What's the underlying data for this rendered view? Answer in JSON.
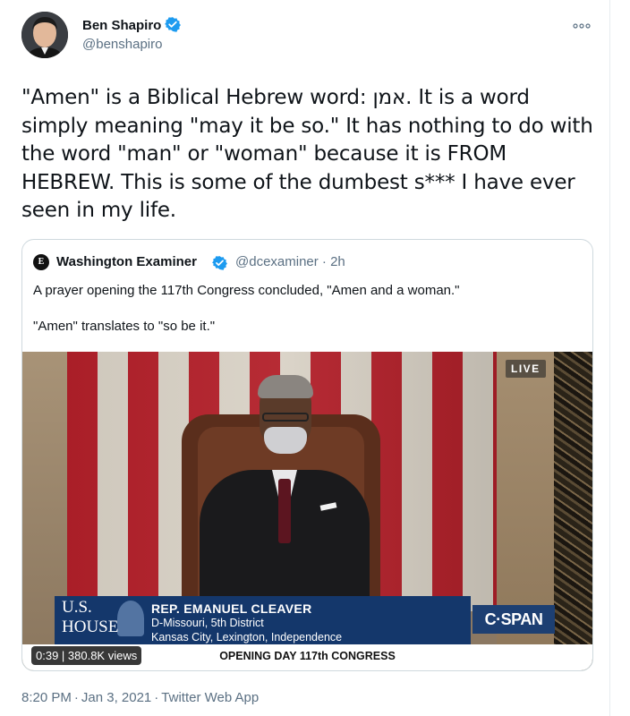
{
  "author": {
    "name": "Ben Shapiro",
    "handle": "@benshapiro",
    "verified": true
  },
  "tweet": {
    "text": "\"Amen\" is a Biblical Hebrew word: אמן. It is a word simply meaning \"may it be so.\" It has nothing to do with the word \"man\" or \"woman\" because it is FROM HEBREW. This is some of the dumbest s*** I have ever seen in my life."
  },
  "quote": {
    "name": "Washington Examiner",
    "handle": "@dcexaminer · 2h",
    "verified": true,
    "text1": "A prayer opening the 117th Congress concluded, \"Amen and a woman.\"",
    "text2": "\"Amen\" translates to \"so be it.\"",
    "video": {
      "live_label": "LIVE",
      "house_line1": "U.S.",
      "house_line2": "HOUSE",
      "speaker_name": "REP. EMANUEL CLEAVER",
      "speaker_district": "D-Missouri, 5th District",
      "speaker_places": "Kansas City, Lexington, Independence",
      "network": "C·SPAN",
      "bottom_text": "OPENING DAY 117th CONGRESS",
      "duration": "0:39 | 380.8K views"
    }
  },
  "meta": {
    "time": "8:20 PM",
    "date": "Jan 3, 2021",
    "source": "Twitter Web App"
  },
  "icons": {
    "more": "more-options-icon",
    "verified": "verified-badge-icon"
  },
  "colors": {
    "verified": "#1d9bf0",
    "secondary_text": "#5b7083",
    "border": "#cfd9de",
    "cspan_blue": "#1d3f72"
  }
}
